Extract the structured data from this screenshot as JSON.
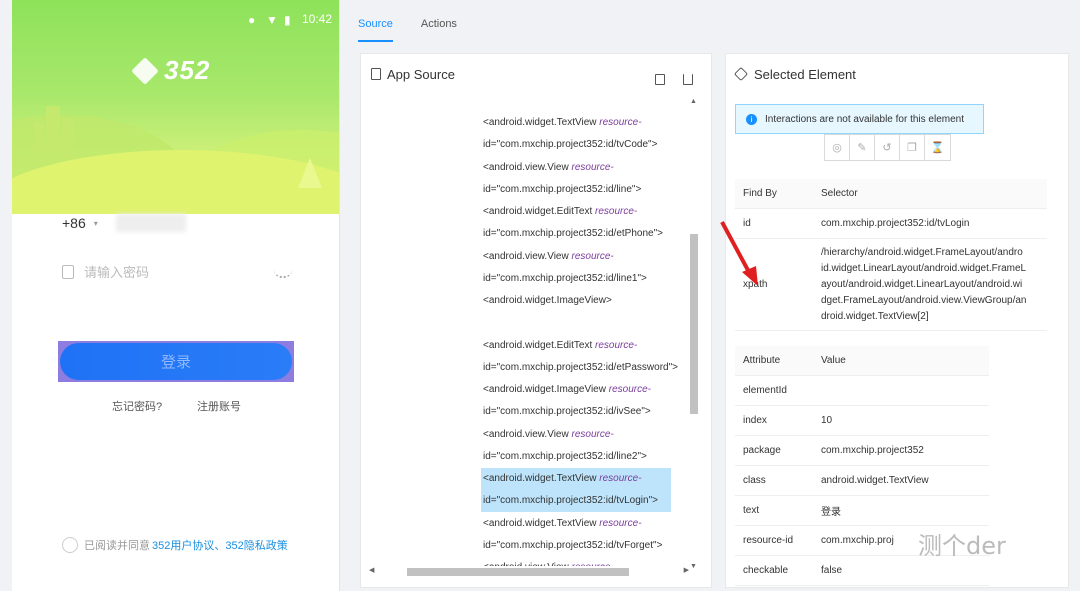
{
  "phone": {
    "status_time": "10:42",
    "logo_text": "352",
    "country_code": "+86",
    "password_placeholder": "请输入密码",
    "login_button": "登录",
    "forgot_password": "忘记密码?",
    "register": "注册账号",
    "agree_prefix": "已阅读并同意",
    "agree_links": "352用户协议、352隐私政策"
  },
  "tabs": [
    {
      "label": "Source"
    },
    {
      "label": "Actions"
    }
  ],
  "source": {
    "title": "App Source",
    "nodes": [
      {
        "tag": "<android.widget.TextView",
        "attr": "resource-",
        "id": "id=\"com.mxchip.project352:id/tvCode\">"
      },
      {
        "tag": "<android.view.View",
        "attr": "resource-",
        "id": "id=\"com.mxchip.project352:id/line\">"
      },
      {
        "tag": "<android.widget.EditText",
        "attr": "resource-",
        "id": "id=\"com.mxchip.project352:id/etPhone\">"
      },
      {
        "tag": "<android.view.View",
        "attr": "resource-",
        "id": "id=\"com.mxchip.project352:id/line1\">"
      },
      {
        "tag": "<android.widget.ImageView>",
        "attr": "",
        "id": ""
      },
      {
        "tag": "<android.widget.EditText",
        "attr": "resource-",
        "id": "id=\"com.mxchip.project352:id/etPassword\">"
      },
      {
        "tag": "<android.widget.ImageView",
        "attr": "resource-",
        "id": "id=\"com.mxchip.project352:id/ivSee\">"
      },
      {
        "tag": "<android.view.View",
        "attr": "resource-",
        "id": "id=\"com.mxchip.project352:id/line2\">"
      },
      {
        "tag": "<android.widget.TextView",
        "attr": "resource-",
        "id": "id=\"com.mxchip.project352:id/tvLogin\">"
      },
      {
        "tag": "<android.widget.TextView",
        "attr": "resource-",
        "id": "id=\"com.mxchip.project352:id/tvForget\">"
      },
      {
        "tag": "<android.view.View",
        "attr": "resource-",
        "id": ""
      }
    ]
  },
  "selected": {
    "title": "Selected Element",
    "notice": "Interactions are not available for this element",
    "find_by_header": "Find By",
    "selector_header": "Selector",
    "id_label": "id",
    "id_value": "com.mxchip.project352:id/tvLogin",
    "xpath_label": "xpath",
    "xpath_lines": [
      "/hierarchy/android.widget.FrameLayout/andro",
      "id.widget.LinearLayout/android.widget.FrameL",
      "ayout/android.widget.LinearLayout/android.wi",
      "dget.FrameLayout/android.view.ViewGroup/an",
      "droid.widget.TextView[2]"
    ],
    "attribute_header": "Attribute",
    "value_header": "Value",
    "attributes": [
      {
        "name": "elementId",
        "value": ""
      },
      {
        "name": "index",
        "value": "10"
      },
      {
        "name": "package",
        "value": "com.mxchip.project352"
      },
      {
        "name": "class",
        "value": "android.widget.TextView"
      },
      {
        "name": "text",
        "value": "登录"
      },
      {
        "name": "resource-id",
        "value": "com.mxchip.proj"
      },
      {
        "name": "checkable",
        "value": "false"
      }
    ]
  },
  "watermark": "测个der"
}
